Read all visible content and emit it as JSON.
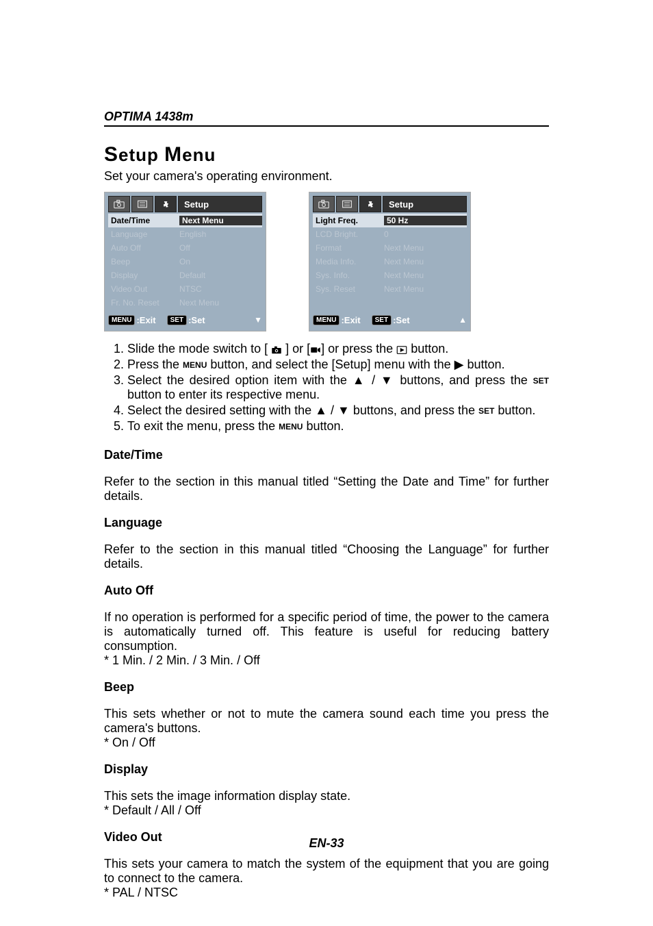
{
  "header": {
    "model": "OPTIMA 1438m"
  },
  "title": {
    "line": "Setup Menu"
  },
  "subtitle": "Set your camera's operating environment.",
  "shot1": {
    "tab_title": "Setup",
    "rows": [
      {
        "k": "Date/Time",
        "v": "Next Menu",
        "on": true
      },
      {
        "k": "Language",
        "v": "English"
      },
      {
        "k": "Auto Off",
        "v": "Off"
      },
      {
        "k": "Beep",
        "v": "On"
      },
      {
        "k": "Display",
        "v": "Default"
      },
      {
        "k": "Video Out",
        "v": "NTSC"
      },
      {
        "k": "Fr. No. Reset",
        "v": "Next Menu"
      }
    ],
    "foot_exit": ":Exit",
    "foot_set": ":Set",
    "menu_pill": "MENU",
    "set_pill": "SET",
    "arrow": "down"
  },
  "shot2": {
    "tab_title": "Setup",
    "rows": [
      {
        "k": "Light Freq.",
        "v": "50 Hz",
        "on": true
      },
      {
        "k": "LCD Bright.",
        "v": "0"
      },
      {
        "k": "Format",
        "v": "Next Menu"
      },
      {
        "k": "Media Info.",
        "v": "Next Menu"
      },
      {
        "k": "Sys. Info.",
        "v": "Next Menu"
      },
      {
        "k": "Sys. Reset",
        "v": "Next Menu"
      },
      {
        "k": "",
        "v": ""
      }
    ],
    "foot_exit": ":Exit",
    "foot_set": ":Set",
    "menu_pill": "MENU",
    "set_pill": "SET",
    "arrow": "up"
  },
  "steps": {
    "s1a": "Slide the mode switch to [ ",
    "s1b": " ] or [",
    "s1c": "] or press the ",
    "s1d": " button.",
    "s2a": "Press the ",
    "s2b": " button, and select the [Setup] menu with the ",
    "s2c": " button.",
    "s3a": "Select the desired option item with the ",
    "s3b": " / ",
    "s3c": " buttons, and press the ",
    "s3d": " button to enter its respective menu.",
    "s4a": "Select the desired setting with the ",
    "s4b": " / ",
    "s4c": " buttons, and press the ",
    "s4d": " button.",
    "s5a": "To exit the menu, press the ",
    "s5b": " button.",
    "menu_sc": "MENU",
    "set_sc": "SET"
  },
  "sec": {
    "datetime_h": "Date/Time",
    "datetime_b": "Refer to the section in this manual titled “Setting the Date and Time” for further details.",
    "lang_h": "Language",
    "lang_b": "Refer to the section in this manual titled “Choosing the Language” for further details.",
    "auto_h": "Auto Off",
    "auto_b1": "If no operation is performed for a specific period of time, the power to the camera is automatically turned off. This feature is useful for reducing battery consumption.",
    "auto_b2": "* 1 Min. / 2 Min. / 3 Min. / Off",
    "beep_h": "Beep",
    "beep_b1": "This sets whether or not to mute the camera sound each time you press the camera's buttons.",
    "beep_b2": "* On / Off",
    "disp_h": "Display",
    "disp_b1": "This sets the image information display state.",
    "disp_b2": "* Default / All / Off",
    "vout_h": "Video Out",
    "vout_b1": "This sets your camera to match the system of the equipment that you are going to connect to the camera.",
    "vout_b2": "* PAL / NTSC"
  },
  "footer": "EN-33"
}
